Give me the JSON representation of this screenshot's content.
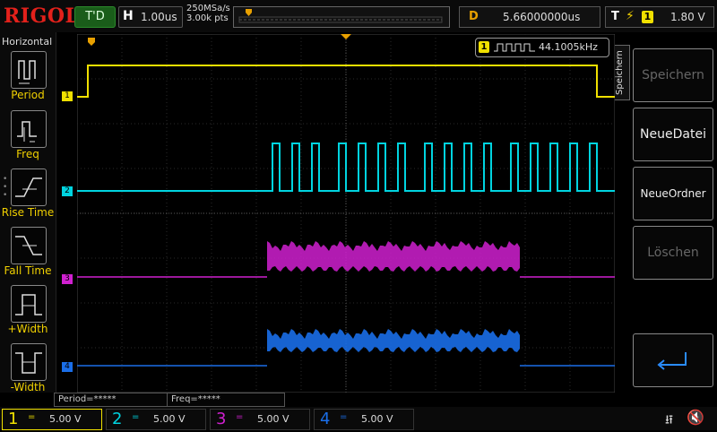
{
  "header": {
    "brand": "RIGOL",
    "run_status": "T'D",
    "timebase_key": "H",
    "timebase_value": "1.00us",
    "sample_rate": "250MSa/s",
    "memory_depth": "3.00k pts",
    "delay_key": "D",
    "delay_value": "5.66000000us",
    "trigger_key": "T",
    "trigger_edge_icon": "rising-edge-icon",
    "trigger_source": "1",
    "trigger_level": "1.80 V"
  },
  "left_menu": {
    "title": "Horizontal",
    "items": [
      {
        "label": "Period",
        "icon": "period-icon"
      },
      {
        "label": "Freq",
        "icon": "freq-icon"
      },
      {
        "label": "Rise Time",
        "icon": "rise-time-icon"
      },
      {
        "label": "Fall Time",
        "icon": "fall-time-icon"
      },
      {
        "label": "+Width",
        "icon": "positive-width-icon"
      },
      {
        "label": "-Width",
        "icon": "negative-width-icon"
      }
    ]
  },
  "right_menu": {
    "tab_label": "Speichern",
    "buttons": [
      {
        "label": "Speichern",
        "enabled": false
      },
      {
        "label": "NeueDatei",
        "enabled": true
      },
      {
        "label": "NeueOrdner",
        "enabled": true
      },
      {
        "label": "Löschen",
        "enabled": false
      },
      {
        "label": "",
        "icon": "enter-arrow-icon"
      }
    ]
  },
  "screen": {
    "freq_badge_channel": "1",
    "freq_badge_value": "44.1005kHz",
    "channel_markers": [
      "1",
      "2",
      "3",
      "4"
    ],
    "measurements": [
      "Period=*****",
      "Freq=*****"
    ]
  },
  "channels": [
    {
      "number": "1",
      "coupling": "=",
      "scale": "5.00 V",
      "color": "#f0e000",
      "active": true
    },
    {
      "number": "2",
      "coupling": "=",
      "scale": "5.00 V",
      "color": "#00d4e0",
      "active": false
    },
    {
      "number": "3",
      "coupling": "=",
      "scale": "5.00 V",
      "color": "#d020d0",
      "active": false
    },
    {
      "number": "4",
      "coupling": "=",
      "scale": "5.00 V",
      "color": "#1a6ee8",
      "active": false
    }
  ],
  "colors": {
    "ch1": "#f0e000",
    "ch2": "#00d4e0",
    "ch3": "#d020d0",
    "ch4": "#1a6ee8",
    "trigger_marker": "#e8a000"
  }
}
